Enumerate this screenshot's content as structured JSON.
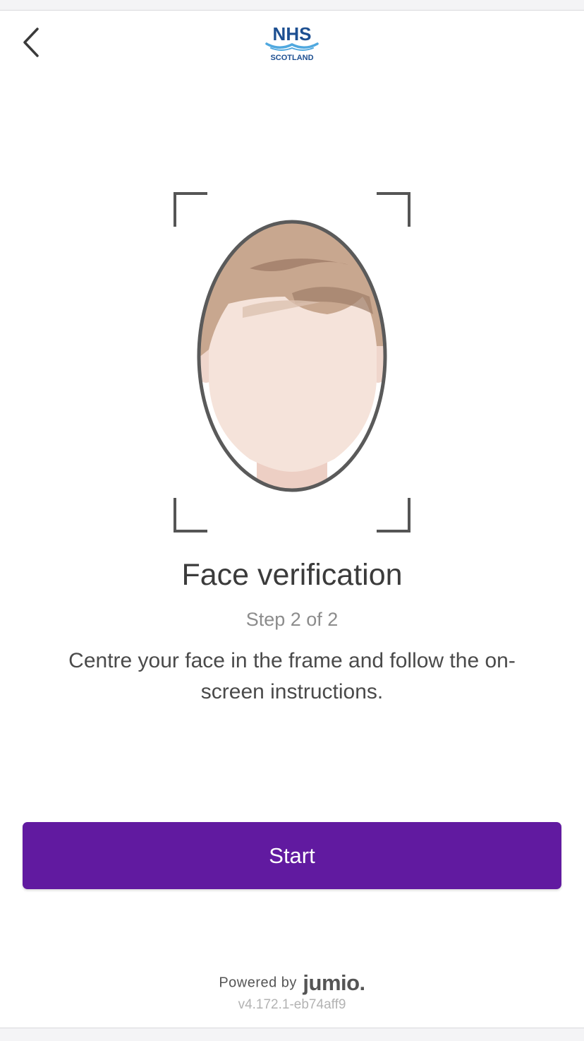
{
  "header": {
    "back_icon": "chevron-left-icon",
    "logo_primary": "NHS",
    "logo_secondary": "SCOTLAND"
  },
  "main": {
    "title": "Face verification",
    "step": "Step 2 of 2",
    "instructions": "Centre your face in the frame and follow the on-screen instructions."
  },
  "actions": {
    "start_label": "Start"
  },
  "footer": {
    "powered_by": "Powered by",
    "brand": "jumio.",
    "version": "v4.172.1-eb74aff9"
  },
  "colors": {
    "accent": "#611aa0",
    "nhs_blue": "#1d4f91",
    "nhs_wave": "#4fa8df"
  }
}
